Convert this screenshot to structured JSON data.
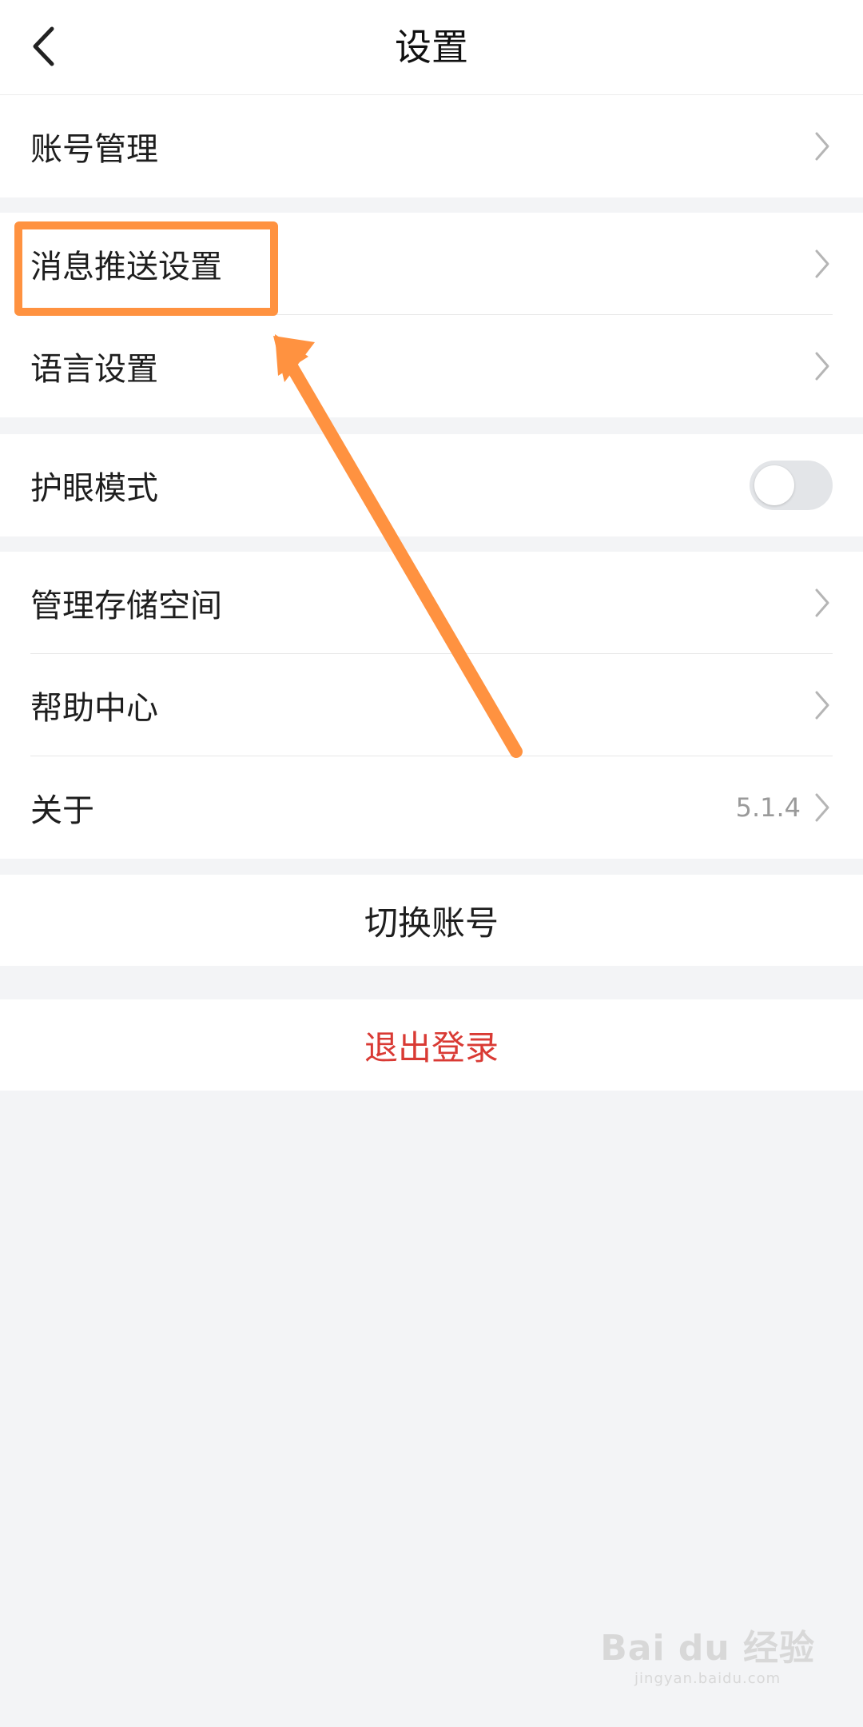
{
  "header": {
    "title": "设置"
  },
  "groups": {
    "account": {
      "items": [
        {
          "label": "账号管理"
        }
      ]
    },
    "notifications": {
      "items": [
        {
          "label": "消息推送设置"
        },
        {
          "label": "语言设置"
        }
      ]
    },
    "display": {
      "items": [
        {
          "label": "护眼模式",
          "toggle_on": false
        }
      ]
    },
    "general": {
      "items": [
        {
          "label": "管理存储空间"
        },
        {
          "label": "帮助中心"
        },
        {
          "label": "关于",
          "value": "5.1.4"
        }
      ]
    }
  },
  "actions": {
    "switch_account": "切换账号",
    "logout": "退出登录"
  },
  "colors": {
    "annotation": "#ff9240",
    "logout": "#d93a34",
    "toggle_off": "#e3e5e8",
    "background": "#f3f4f6"
  },
  "watermark": {
    "main": "Bai du 经验",
    "sub": "jingyan.baidu.com"
  }
}
